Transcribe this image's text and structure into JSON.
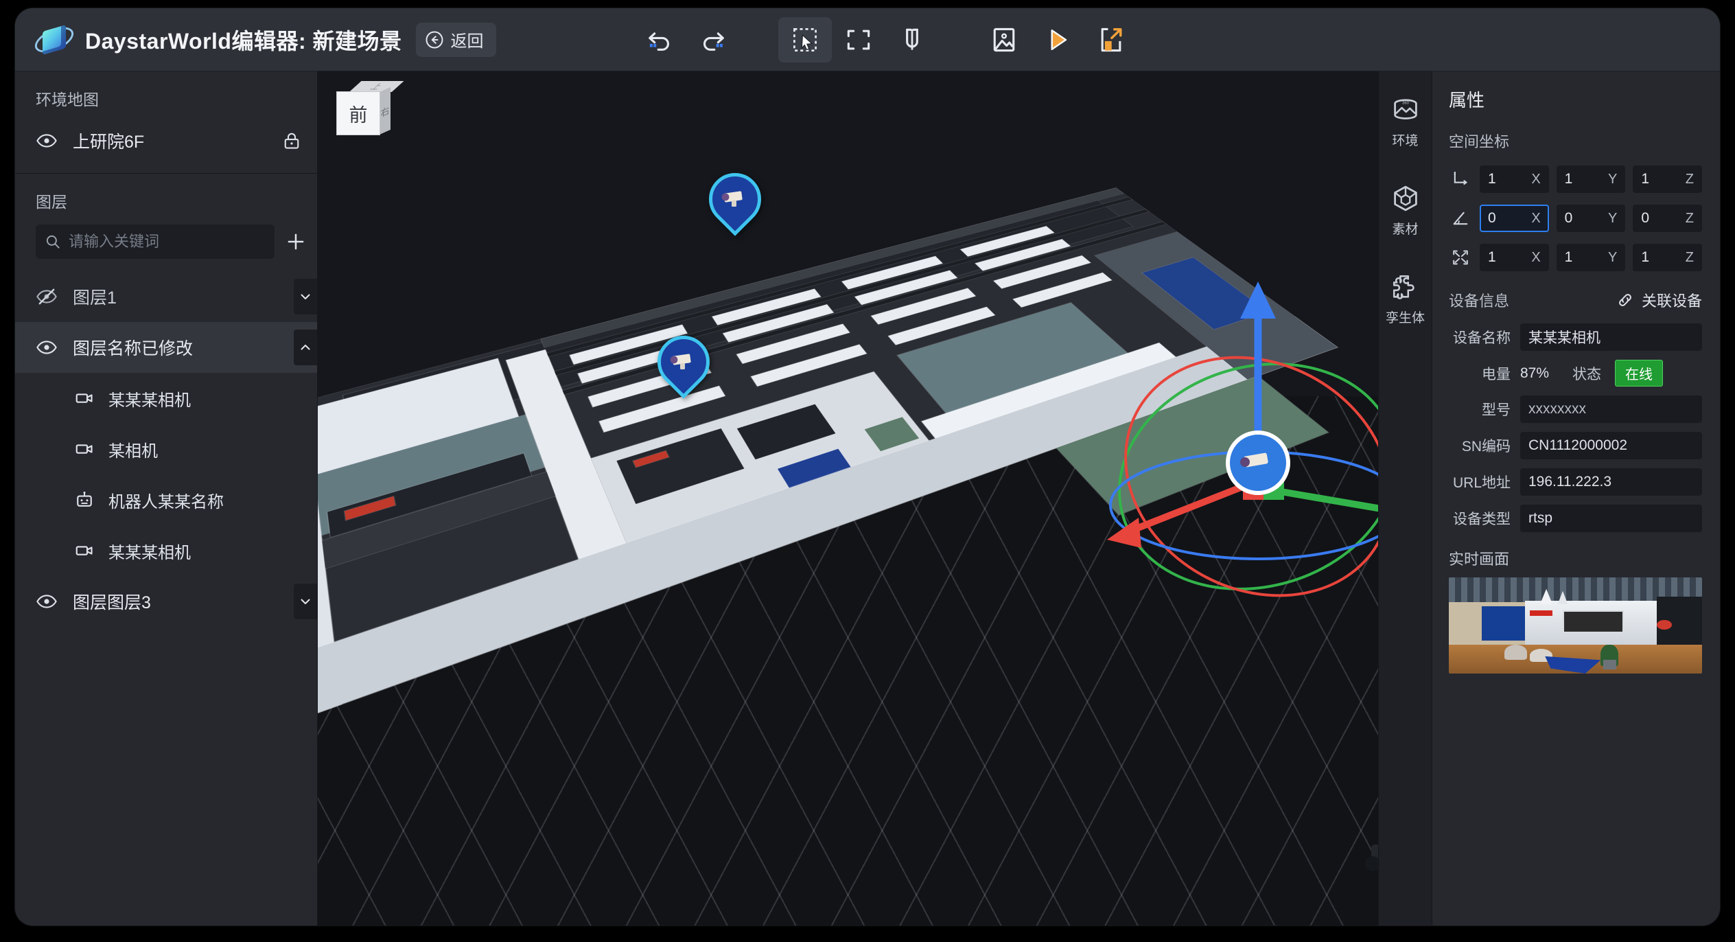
{
  "titlebar": {
    "logo_icon": "daystar-logo-icon",
    "title": "DaystarWorld编辑器: 新建场景",
    "back_label": "返回",
    "back_icon": "arrow-left-circle-icon",
    "tools": [
      {
        "name": "undo",
        "icon": "undo-icon"
      },
      {
        "name": "redo",
        "icon": "redo-icon"
      },
      {
        "name": "select",
        "icon": "select-cursor-icon",
        "selected": true
      },
      {
        "name": "frame",
        "icon": "frame-focus-icon"
      },
      {
        "name": "magnet",
        "icon": "magnet-snap-icon"
      },
      {
        "name": "image",
        "icon": "image-icon"
      },
      {
        "name": "play",
        "icon": "play-icon"
      },
      {
        "name": "export",
        "icon": "export-icon"
      }
    ]
  },
  "left_panel": {
    "envmap_title": "环境地图",
    "envmap_item": {
      "label": "上研院6F",
      "eye_icon": "eye-icon",
      "lock_icon": "lock-icon"
    },
    "layers_title": "图层",
    "search_placeholder": "请输入关键词",
    "search_value": "",
    "search_icon": "search-icon",
    "add_icon": "plus-icon",
    "layers": [
      {
        "label": "图层1",
        "visible": false,
        "expanded": false,
        "active": false,
        "children": []
      },
      {
        "label": "图层名称已修改",
        "visible": true,
        "expanded": true,
        "active": true,
        "children": [
          {
            "label": "某某某相机",
            "icon": "camera-icon"
          },
          {
            "label": "某相机",
            "icon": "camera-icon"
          },
          {
            "label": "机器人某某名称",
            "icon": "robot-icon"
          },
          {
            "label": "某某某相机",
            "icon": "camera-icon"
          }
        ]
      },
      {
        "label": "图层图层3",
        "visible": true,
        "expanded": false,
        "active": false,
        "children": []
      }
    ]
  },
  "viewport": {
    "view_cube": {
      "front": "前",
      "right": "右",
      "top": "上"
    },
    "markers": [
      {
        "name": "camera-marker-1",
        "icon": "cctv-camera-icon"
      },
      {
        "name": "camera-marker-2",
        "icon": "cctv-camera-icon"
      },
      {
        "name": "camera-marker-selected",
        "icon": "cctv-camera-icon"
      }
    ],
    "gizmo": {
      "x_color": "#e8453c",
      "y_color": "#33b44a",
      "z_color": "#3a7bf0"
    }
  },
  "rail": [
    {
      "label": "环境",
      "icon": "panorama-360-icon"
    },
    {
      "label": "素材",
      "icon": "cube-asset-icon"
    },
    {
      "label": "孪生体",
      "icon": "puzzle-piece-icon"
    }
  ],
  "right_panel": {
    "title": "属性",
    "coords_title": "空间坐标",
    "rows": [
      {
        "icon": "position-axis-icon",
        "fields": [
          {
            "value": "1",
            "axis": "X",
            "focused": false
          },
          {
            "value": "1",
            "axis": "Y",
            "focused": false
          },
          {
            "value": "1",
            "axis": "Z",
            "focused": false
          }
        ]
      },
      {
        "icon": "rotation-angle-icon",
        "fields": [
          {
            "value": "0",
            "axis": "X",
            "focused": true
          },
          {
            "value": "0",
            "axis": "Y",
            "focused": false
          },
          {
            "value": "0",
            "axis": "Z",
            "focused": false
          }
        ]
      },
      {
        "icon": "scale-icon",
        "fields": [
          {
            "value": "1",
            "axis": "X",
            "focused": false
          },
          {
            "value": "1",
            "axis": "Y",
            "focused": false
          },
          {
            "value": "1",
            "axis": "Z",
            "focused": false
          }
        ]
      }
    ],
    "device_title": "设备信息",
    "link_label": "关联设备",
    "link_icon": "link-chain-icon",
    "device_name_label": "设备名称",
    "device_name_value": "某某某相机",
    "battery_label": "电量",
    "battery_value": "87%",
    "status_label": "状态",
    "status_value": "在线",
    "status_color": "#1f9d32",
    "model_label": "型号",
    "model_value": "xxxxxxxx",
    "sn_label": "SN编码",
    "sn_value": "CN1112000002",
    "url_label": "URL地址",
    "url_value": "196.11.222.3",
    "type_label": "设备类型",
    "type_value": "rtsp",
    "live_title": "实时画面"
  }
}
